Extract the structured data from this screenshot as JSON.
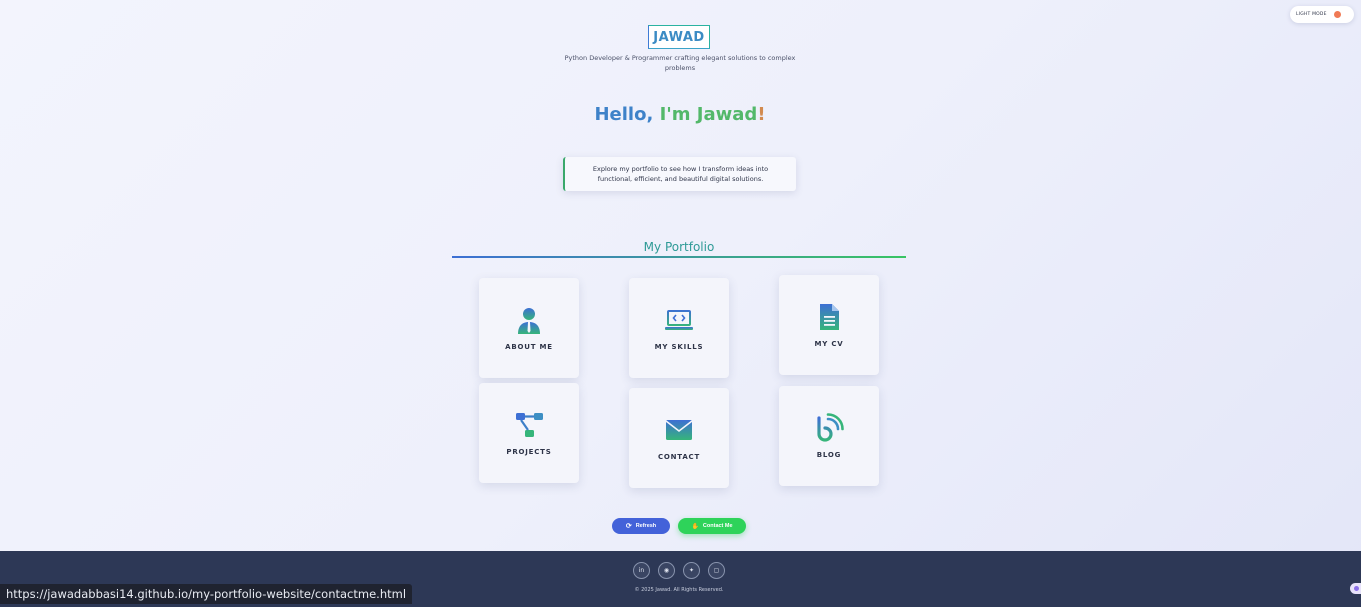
{
  "header": {
    "logo": "JAWAD",
    "tagline": "Python Developer & Programmer crafting elegant solutions to complex problems"
  },
  "hero": {
    "hello_part1": "Hello,",
    "hello_part2": "I'm Jawad",
    "hello_part3": "!",
    "intro": "Explore my portfolio to see how I transform ideas into functional, efficient, and beautiful digital solutions."
  },
  "portfolio": {
    "title": "My Portfolio",
    "cards": [
      {
        "label": "ABOUT ME",
        "icon": "user-icon"
      },
      {
        "label": "MY SKILLS",
        "icon": "laptop-code-icon"
      },
      {
        "label": "MY CV",
        "icon": "document-icon"
      },
      {
        "label": "PROJECTS",
        "icon": "project-diagram-icon"
      },
      {
        "label": "CONTACT",
        "icon": "envelope-icon"
      },
      {
        "label": "BLOG",
        "icon": "blog-icon"
      }
    ]
  },
  "actions": {
    "refresh_label": "Refresh",
    "contact_label": "Contact Me"
  },
  "theme_toggle": {
    "label": "LIGHT MODE"
  },
  "footer": {
    "social": [
      "linkedin-icon",
      "github-icon",
      "twitter-icon",
      "instagram-icon"
    ],
    "copyright": "© 2025 Jawad. All Rights Reserved."
  },
  "status_bar": {
    "url": "https://jawadabbasi14.github.io/my-portfolio-website/contactme.html"
  },
  "colors": {
    "accent_blue": "#3e82c9",
    "accent_green": "#53b86a",
    "accent_orange": "#d28a4f",
    "refresh_button": "#4362d9",
    "contact_button": "#2ed35a",
    "footer_bg": "#2d3856"
  }
}
